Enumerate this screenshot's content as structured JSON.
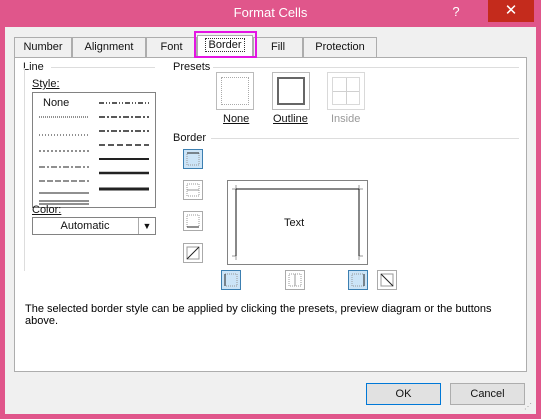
{
  "window": {
    "title": "Format Cells",
    "help": "?",
    "close": "✕"
  },
  "tabs": [
    {
      "label": "Number"
    },
    {
      "label": "Alignment"
    },
    {
      "label": "Font"
    },
    {
      "label": "Border"
    },
    {
      "label": "Fill"
    },
    {
      "label": "Protection"
    }
  ],
  "active_tab": "Border",
  "line": {
    "group_label": "Line",
    "style_label": "Style:",
    "style_none": "None",
    "color_label": "Color:",
    "color_value": "Automatic"
  },
  "presets": {
    "group_label": "Presets",
    "items": [
      {
        "label": "None",
        "enabled": true
      },
      {
        "label": "Outline",
        "enabled": true
      },
      {
        "label": "Inside",
        "enabled": false
      }
    ]
  },
  "border": {
    "group_label": "Border",
    "preview_text": "Text"
  },
  "description": "The selected border style can be applied by clicking the presets, preview diagram or the buttons above.",
  "buttons": {
    "ok": "OK",
    "cancel": "Cancel"
  },
  "colors": {
    "highlight": "#e415e4",
    "selected_btn": "#cce4f7",
    "titlebar": "#e0568b"
  }
}
